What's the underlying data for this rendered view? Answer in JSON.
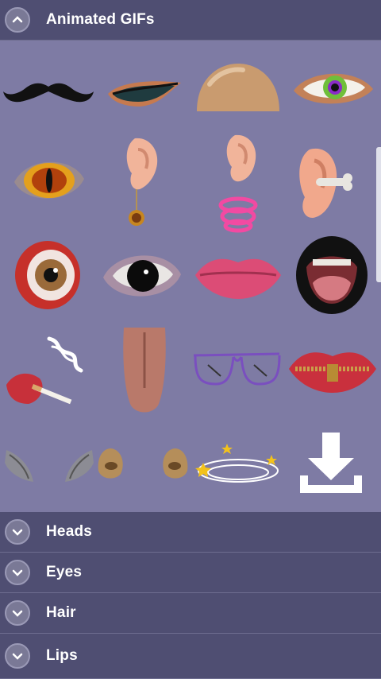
{
  "sections": {
    "animated": {
      "label": "Animated GIFs"
    },
    "heads": {
      "label": "Heads"
    },
    "eyes": {
      "label": "Eyes"
    },
    "hair": {
      "label": "Hair"
    },
    "lips": {
      "label": "Lips"
    }
  },
  "stickers": [
    "mustache",
    "eye-liner",
    "bald-head",
    "green-eye",
    "dragon-eye",
    "ear-earring",
    "ear-pink-ring",
    "ear-with-bone",
    "red-eyeball",
    "black-eye",
    "pink-lips",
    "open-mouth",
    "lips-cigarette",
    "tongue",
    "glasses",
    "zipper-lips",
    "wing-left",
    "wing-right",
    "nostril-left",
    "nostril-right",
    "dizzy-stars",
    "download-icon"
  ],
  "colors": {
    "header_bg": "#4f4e72",
    "grid_bg": "#7e7ba4",
    "header_text": "#ffffff"
  }
}
